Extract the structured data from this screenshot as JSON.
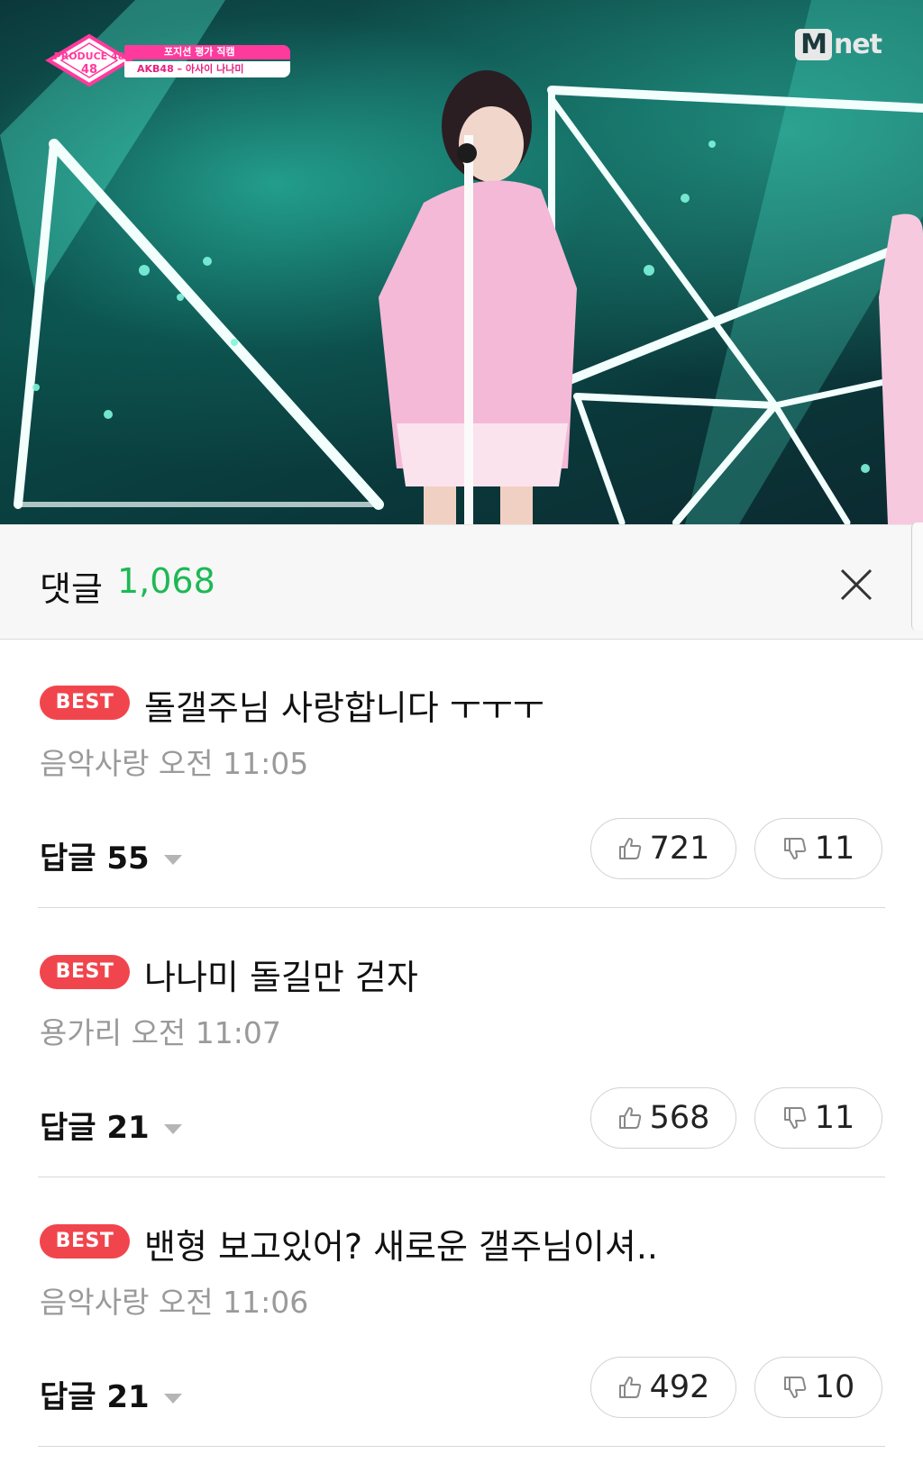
{
  "video": {
    "channel_logo": "Mnet",
    "show_logo": "PRODUCE 48",
    "show_logo_number": "48",
    "caption_line1": "포지션 평가 직캠",
    "caption_line2": "AKB48 – 아사이 나나미"
  },
  "comments_header": {
    "title": "댓글",
    "count": "1,068",
    "close_icon": "close-icon"
  },
  "comments": [
    {
      "badge": "BEST",
      "text": "돌갤주님 사랑합니다 ㅜㅜㅜ",
      "author_time": "음악사랑 오전 11:05",
      "replies": "답글 55",
      "likes": "721",
      "dislikes": "11"
    },
    {
      "badge": "BEST",
      "text": "나나미 돌길만 걷자",
      "author_time": "용가리 오전 11:07",
      "replies": "답글 21",
      "likes": "568",
      "dislikes": "11"
    },
    {
      "badge": "BEST",
      "text": "밴형 보고있어? 새로운 갤주님이셔..",
      "author_time": "음악사랑 오전 11:06",
      "replies": "답글 21",
      "likes": "492",
      "dislikes": "10"
    }
  ],
  "colors": {
    "accent_count": "#1db954",
    "best_badge": "#f1454d",
    "meta_text": "#9a9a9a"
  }
}
